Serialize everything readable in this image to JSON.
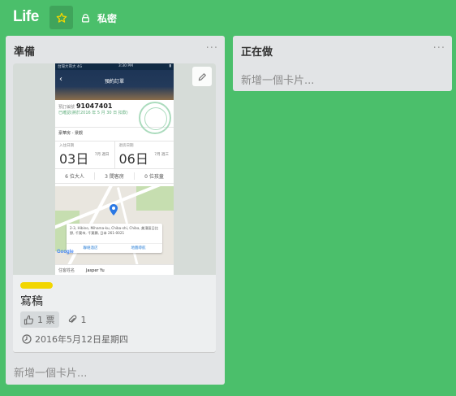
{
  "board": {
    "title": "Life",
    "visibility": "私密",
    "accent": "#4bbf6b"
  },
  "lists": {
    "ready": {
      "title": "準備",
      "menu": "···",
      "add_card": "新增一個卡片...",
      "card": {
        "label_color": "#f2d600",
        "title": "寫稿",
        "votes": "1 票",
        "attachments": "1",
        "due": "2016年5月12日星期四",
        "cover": {
          "status_left": "台灣大哥大 4G",
          "status_time": "3:30 PM",
          "screen_title": "預約訂單",
          "booking_label": "預訂編號",
          "booking_number": "91047401",
          "booking_note": "已確認(將於2016 年 5 月 30 日 扣款)",
          "room_type": "豪華房 - 景觀",
          "checkin_label": "入住日期",
          "checkin_day": "03日",
          "checkin_side": "7月 週日",
          "checkout_label": "退房日期",
          "checkout_day": "06日",
          "checkout_side": "7月 週三",
          "adults": "6 位大人",
          "rooms": "3 間客房",
          "kids": "0 位孩童",
          "address": "2-3, Hibino, Mihama-ku, Chiba-shi, Chiba, 美濱區日比野, 千葉市, 千葉縣, 日本 261-0021",
          "btn_contact": "聯絡酒店",
          "btn_directions": "地圖導航",
          "map_brand": "Google",
          "guest_label": "住客姓名",
          "guest_name": "Jasper Yu"
        }
      }
    },
    "doing": {
      "title": "正在做",
      "menu": "···",
      "add_card": "新增一個卡片..."
    }
  }
}
